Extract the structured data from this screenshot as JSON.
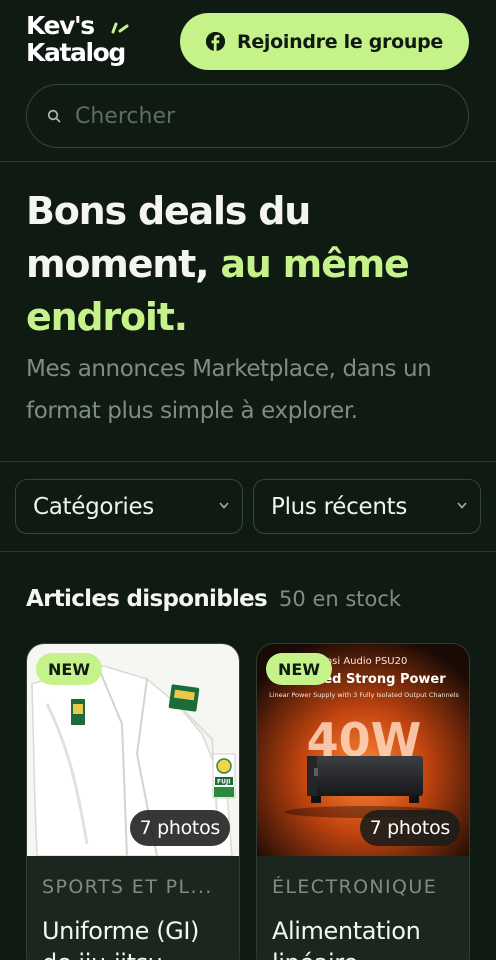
{
  "header": {
    "logo_line1": "Kev's",
    "logo_line2": "Katalog",
    "join_button": "Rejoindre le groupe"
  },
  "search": {
    "placeholder": "Chercher"
  },
  "hero": {
    "title_part1": "Bons deals du moment,",
    "title_accent": "au même endroit.",
    "subtitle": "Mes annonces Marketplace, dans un format plus simple à explorer."
  },
  "filters": {
    "category": "Catégories",
    "sort": "Plus récents"
  },
  "section": {
    "title": "Articles disponibles",
    "count": "50 en stock"
  },
  "products": [
    {
      "badge": "NEW",
      "photos": "7 photos",
      "category": "SPORTS ET PL...",
      "title_line1": "Uniforme (GI)",
      "title_line2": "de jiu-jitsu",
      "image_text": "FUJI"
    },
    {
      "badge": "NEW",
      "photos": "7 photos",
      "category": "ÉLECTRONIQUE",
      "title_line1": "Alimentation",
      "title_line2": "linéaire",
      "image_text": {
        "brand": "Fosi Audio PSU20",
        "headline": "Isolated Strong Power",
        "tagline": "Linear Power Supply with 3 Fully Isolated Output Channels",
        "wattage": "40W"
      }
    }
  ],
  "colors": {
    "background": "#0f1a13",
    "accent": "#c6f28a",
    "muted": "#7f8c83",
    "card": "#1b261f"
  },
  "icons": {
    "facebook": "facebook-icon",
    "search": "search-icon",
    "chevron": "chevron-down-icon"
  }
}
